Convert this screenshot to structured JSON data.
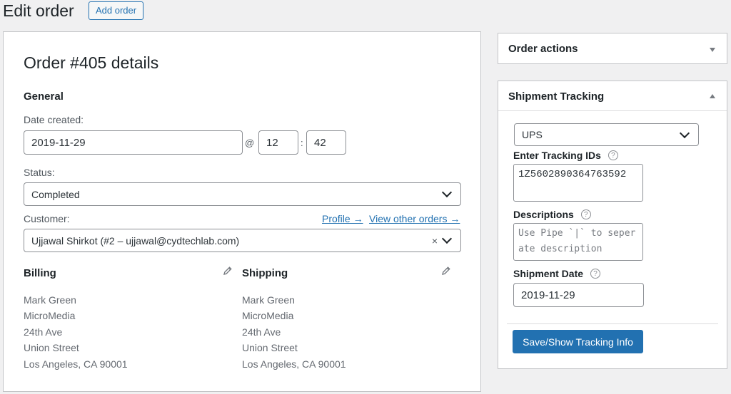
{
  "header": {
    "title": "Edit order",
    "add_order_label": "Add order"
  },
  "order": {
    "title": "Order #405 details",
    "general_heading": "General",
    "date_created_label": "Date created:",
    "date": "2019-11-29",
    "at_sign": "@",
    "hour": "12",
    "colon": ":",
    "minute": "42",
    "status_label": "Status:",
    "status_value": "Completed",
    "customer_label": "Customer:",
    "profile_link": "Profile →",
    "view_orders_link": "View other orders →",
    "customer_value": "Ujjawal Shirkot (#2 – ujjawal@cydtechlab.com)",
    "clear_symbol": "×"
  },
  "billing": {
    "title": "Billing",
    "lines": [
      "Mark Green",
      "MicroMedia",
      "24th Ave",
      "Union Street",
      "Los Angeles, CA 90001"
    ]
  },
  "shipping": {
    "title": "Shipping",
    "lines": [
      "Mark Green",
      "MicroMedia",
      "24th Ave",
      "Union Street",
      "Los Angeles, CA 90001"
    ]
  },
  "order_actions": {
    "title": "Order actions"
  },
  "tracking": {
    "title": "Shipment Tracking",
    "carrier": "UPS",
    "tracking_ids_label": "Enter Tracking IDs",
    "tracking_ids_value": "1Z5602890364763592",
    "descriptions_label": "Descriptions",
    "descriptions_placeholder": "Use Pipe `|` to seperate description",
    "shipment_date_label": "Shipment Date",
    "shipment_date": "2019-11-29",
    "help_symbol": "?",
    "save_button": "Save/Show Tracking Info"
  },
  "colors": {
    "accent": "#2271b1",
    "border": "#c3c4c7",
    "background": "#f0f0f1"
  }
}
